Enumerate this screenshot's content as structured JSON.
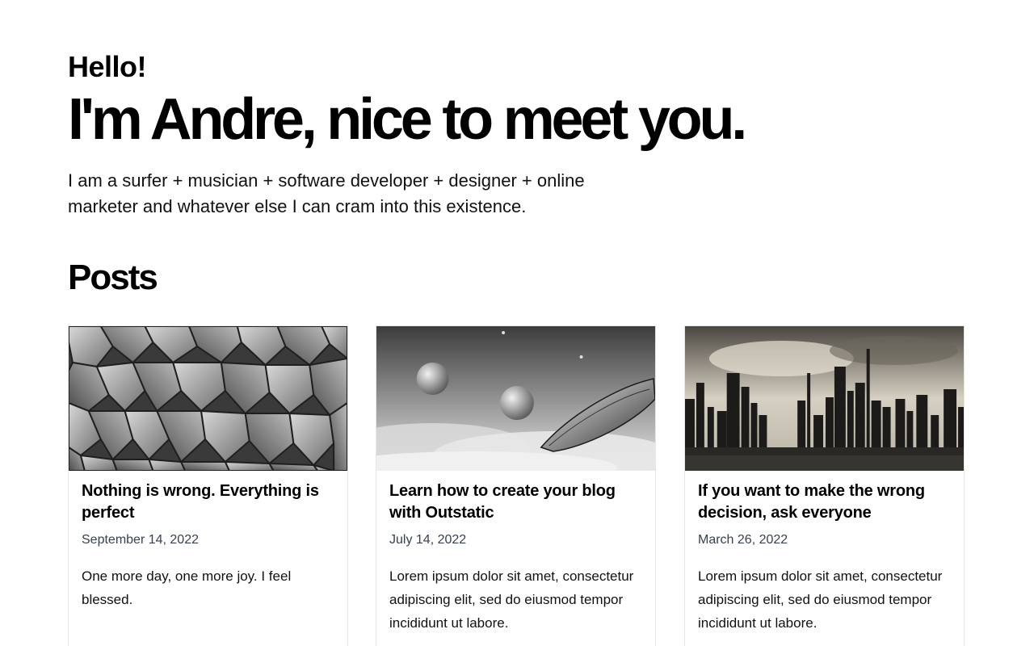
{
  "hero": {
    "greeting": "Hello!",
    "headline": "I'm Andre, nice to meet you.",
    "intro": "I am a surfer + musician + software developer + designer + online marketer and whatever else I can cram into this existence."
  },
  "posts": {
    "heading": "Posts",
    "items": [
      {
        "title": "Nothing is wrong. Everything is perfect",
        "date": "September 14, 2022",
        "excerpt": "One more day, one more joy. I feel blessed.",
        "image_icon": "stone-blocks-image"
      },
      {
        "title": "Learn how to create your blog with Outstatic",
        "date": "July 14, 2022",
        "excerpt": "Lorem ipsum dolor sit amet, consectetur adipiscing elit, sed do eiusmod tempor incididunt ut labore.",
        "image_icon": "space-ship-image"
      },
      {
        "title": "If you want to make the wrong decision, ask everyone",
        "date": "March 26, 2022",
        "excerpt": "Lorem ipsum dolor sit amet, consectetur adipiscing elit, sed do eiusmod tempor incididunt ut labore.",
        "image_icon": "city-skyline-image"
      }
    ]
  },
  "colors": {
    "background": "#ffffff",
    "text": "#000000",
    "date": "#374151",
    "card_border": "#e5e7eb"
  }
}
